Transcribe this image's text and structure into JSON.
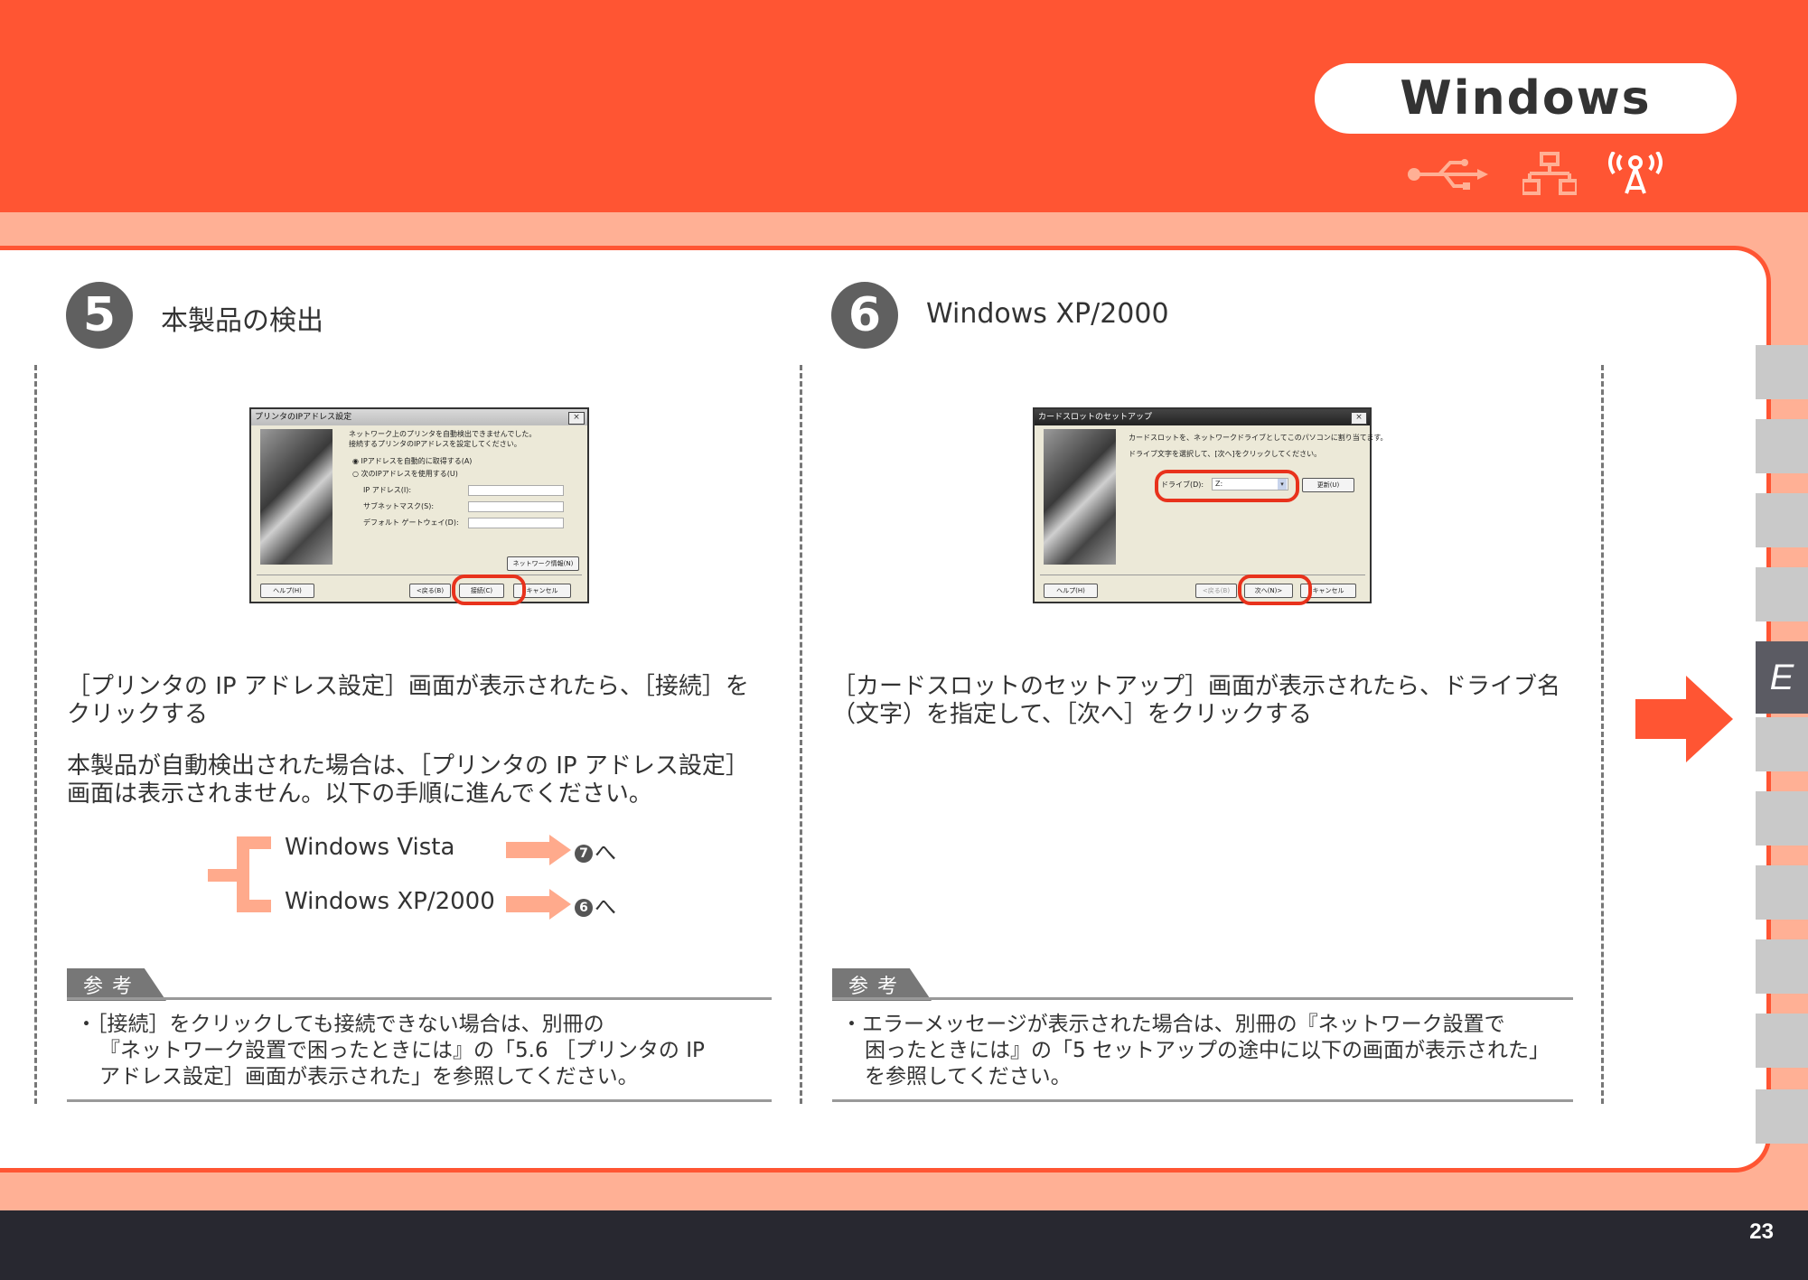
{
  "header": {
    "os_label": "Windows"
  },
  "connection_icons": [
    "usb-icon",
    "network-icon",
    "wireless-icon"
  ],
  "side_tab": {
    "label": "E"
  },
  "page_number": "23",
  "step5": {
    "number": "5",
    "title": "本製品の検出",
    "dialog": {
      "title": "プリンタのIPアドレス設定",
      "message1": "ネットワーク上のプリンタを自動検出できませんでした。",
      "message2": "接続するプリンタのIPアドレスを設定してください。",
      "radio_auto": "IPアドレスを自動的に取得する(A)",
      "radio_manual": "次のIPアドレスを使用する(U)",
      "ip_label": "IP アドレス(I):",
      "subnet_label": "サブネットマスク(S):",
      "gateway_label": "デフォルト ゲートウェイ(D):",
      "network_info_button": "ネットワーク情報(N)",
      "help_button": "ヘルプ(H)",
      "back_button": "<戻る(B)",
      "connect_button": "接続(C)",
      "cancel_button": "キャンセル"
    },
    "instruction_line1": "［プリンタの IP アドレス設定］画面が表示されたら、［接続］を",
    "instruction_line2": "クリックする",
    "note_line1": "本製品が自動検出された場合は、［プリンタの IP アドレス設定］",
    "note_line2": "画面は表示されません。以下の手順に進んでください。",
    "flow": [
      {
        "os": "Windows Vista",
        "target_num": "7",
        "target_suffix": "へ"
      },
      {
        "os": "Windows XP/2000",
        "target_num": "6",
        "target_suffix": "へ"
      }
    ],
    "reference_label": "参考",
    "reference_line1": "・［接続］をクリックしても接続できない場合は、別冊の",
    "reference_line2": "『ネットワーク設置で困ったときには』の「5.6 ［プリンタの IP",
    "reference_line3": "アドレス設定］画面が表示された」を参照してください。"
  },
  "step6": {
    "number": "6",
    "title": "Windows XP/2000",
    "dialog": {
      "title": "カードスロットのセットアップ",
      "message1": "カードスロットを、ネットワークドライブとしてこのパソコンに割り当てます。",
      "message2": "ドライブ文字を選択して、[次へ]をクリックしてください。",
      "drive_label": "ドライブ(D):",
      "drive_value": "Z:",
      "refresh_button": "更新(U)",
      "help_button": "ヘルプ(H)",
      "back_button": "<戻る(B)",
      "next_button": "次へ(N)>",
      "cancel_button": "キャンセル"
    },
    "instruction_line1": "［カードスロットのセットアップ］画面が表示されたら、ドライブ名",
    "instruction_line2": "（文字）を指定して、［次へ］をクリックする",
    "reference_label": "参考",
    "reference_line1": "・エラーメッセージが表示された場合は、別冊の『ネットワーク設置で",
    "reference_line2": "困ったときには』の「5 セットアップの途中に以下の画面が表示された」",
    "reference_line3": "を参照してください。"
  },
  "colors": {
    "accent": "#ff5533",
    "band": "#ffb095",
    "footer": "#282830",
    "highlight": "#e8321c",
    "flow_arrow": "#ffaa8c"
  }
}
